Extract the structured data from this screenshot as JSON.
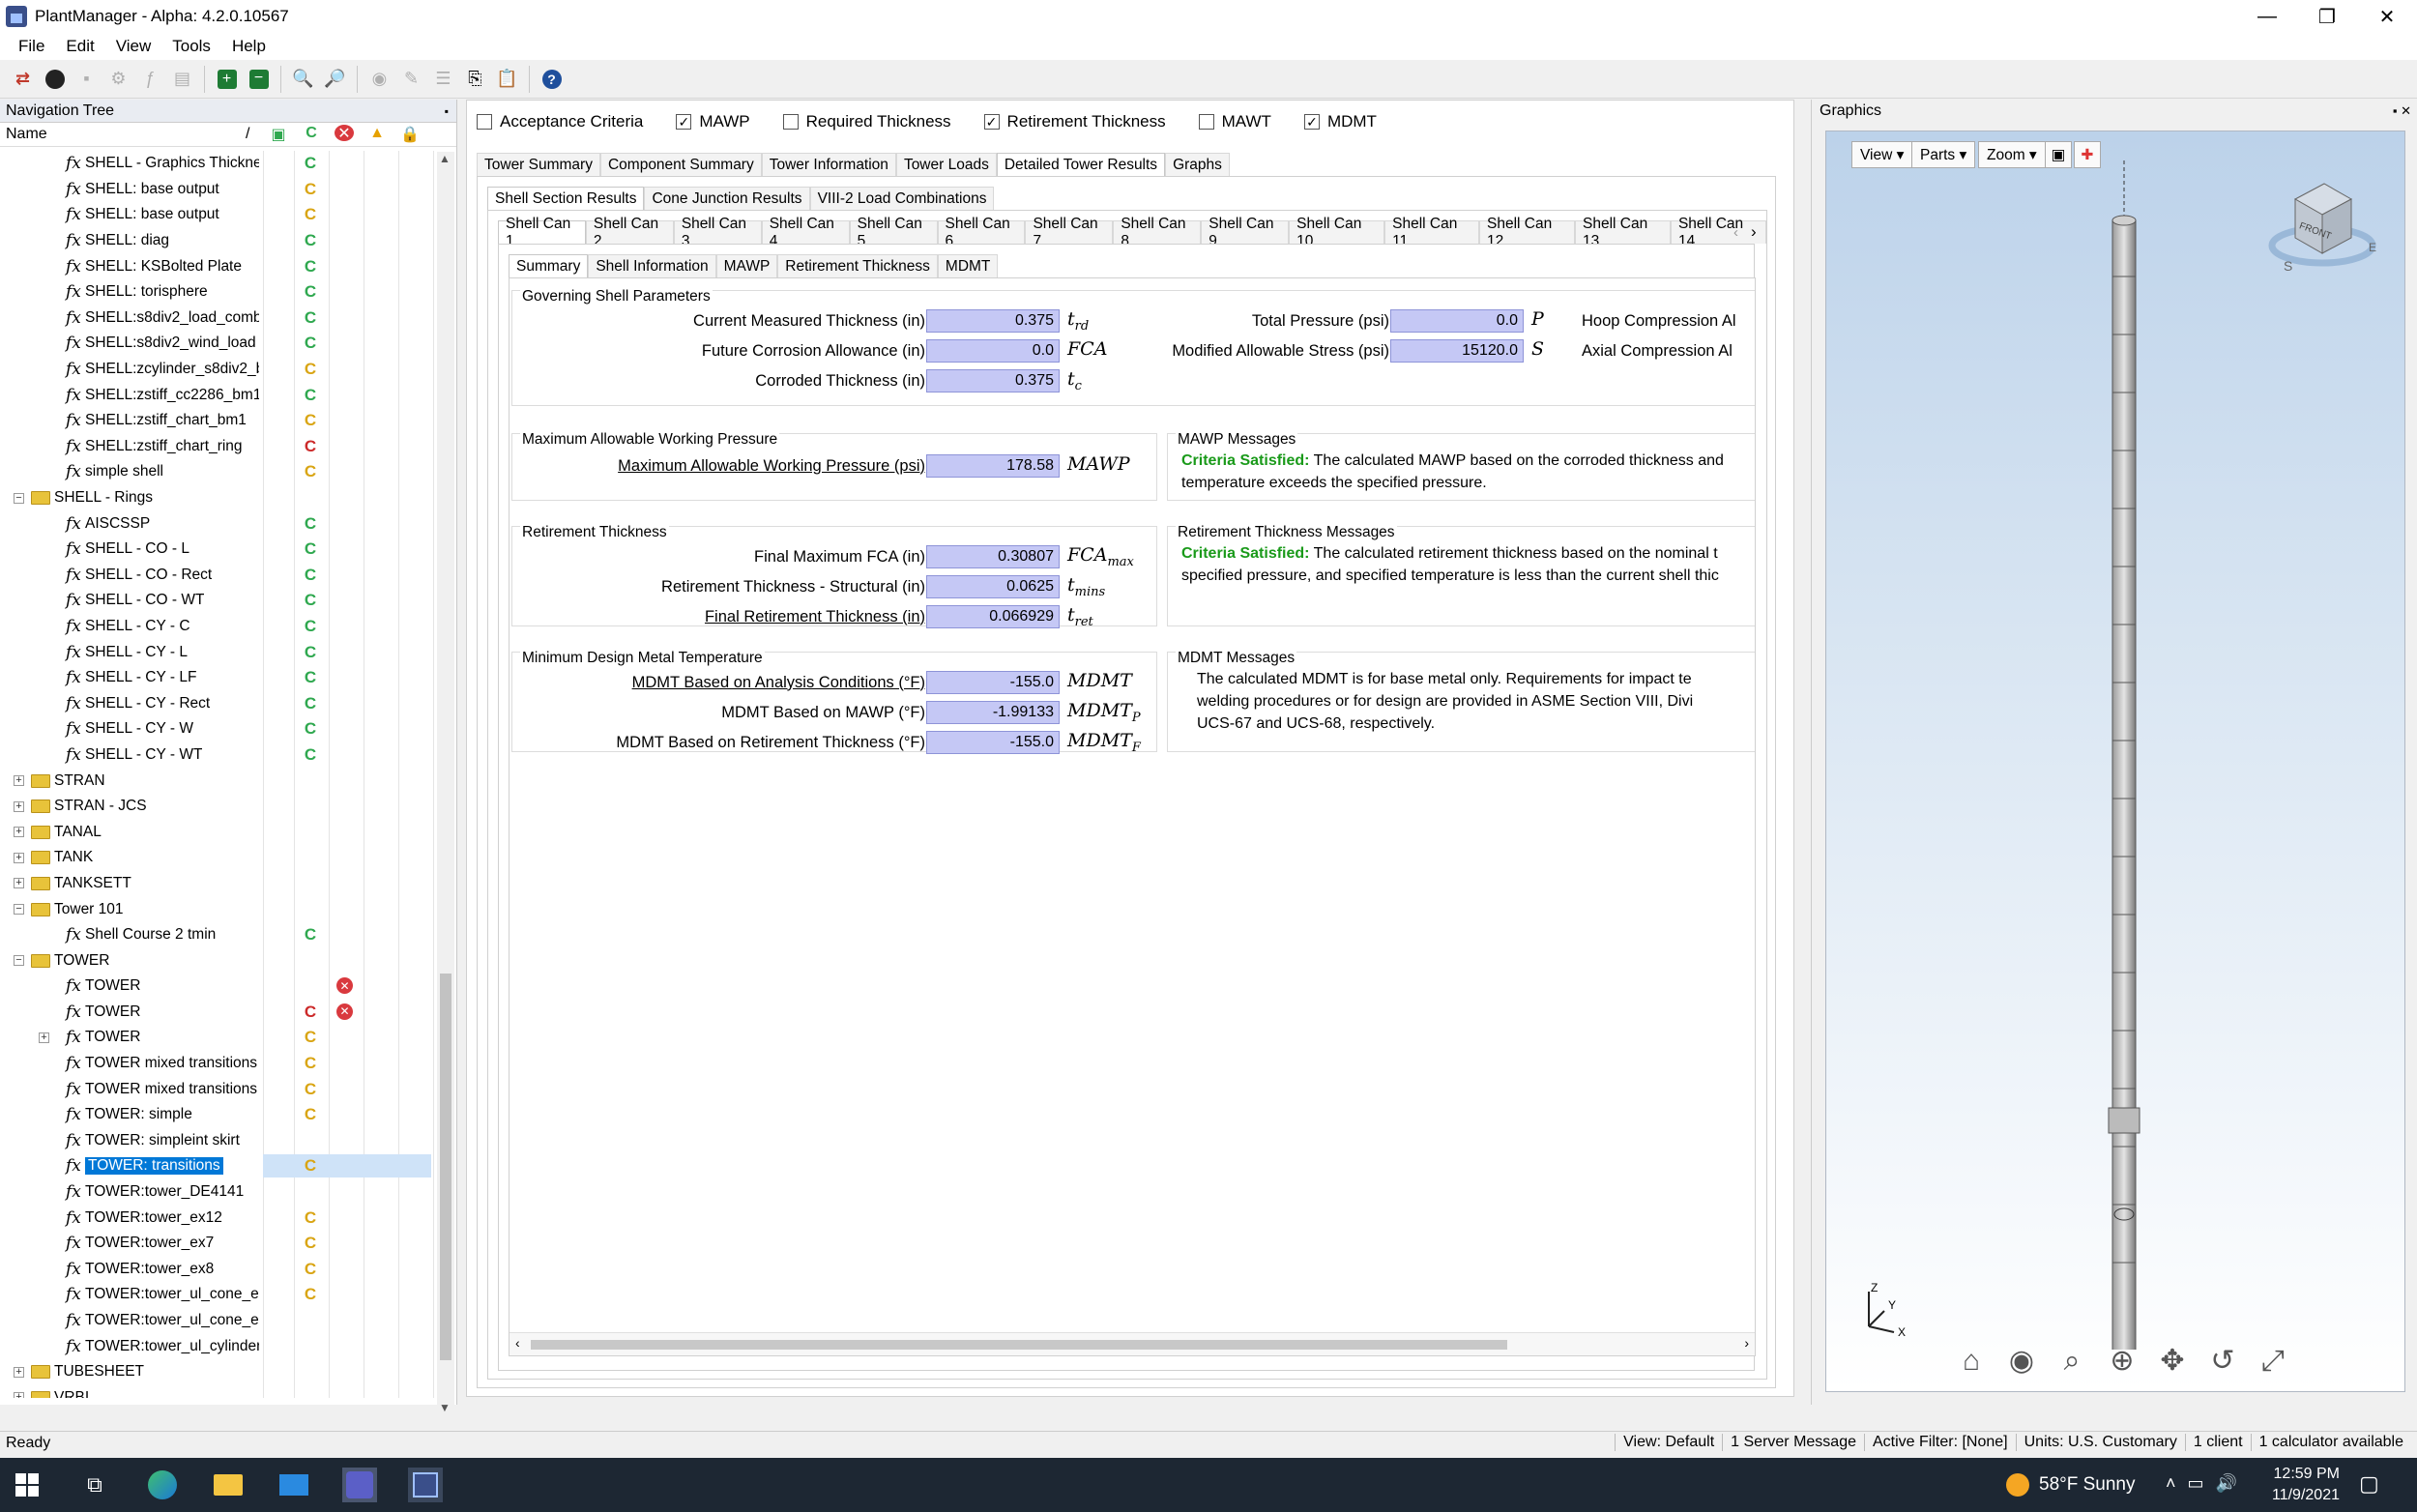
{
  "window": {
    "title": "PlantManager - Alpha: 4.2.0.10567",
    "minimize": "—",
    "maximize": "❐",
    "close": "✕"
  },
  "menu": [
    "File",
    "Edit",
    "View",
    "Tools",
    "Help"
  ],
  "nav": {
    "title": "Navigation Tree",
    "pin": "📌",
    "col_name": "Name",
    "sort_glyph": "/",
    "rows": [
      {
        "label": "SHELL - Graphics Thickness",
        "type": "fx",
        "indent": 2,
        "s1": "green"
      },
      {
        "label": "SHELL: base output",
        "type": "fx",
        "indent": 2,
        "s1": "yellow"
      },
      {
        "label": "SHELL: base output",
        "type": "fx",
        "indent": 2,
        "s1": "yellow"
      },
      {
        "label": "SHELL: diag",
        "type": "fx",
        "indent": 2,
        "s1": "green"
      },
      {
        "label": "SHELL: KSBolted Plate",
        "type": "fx",
        "indent": 2,
        "s1": "green"
      },
      {
        "label": "SHELL: torisphere",
        "type": "fx",
        "indent": 2,
        "s1": "green"
      },
      {
        "label": "SHELL:s8div2_load_comb",
        "type": "fx",
        "indent": 2,
        "s1": "green"
      },
      {
        "label": "SHELL:s8div2_wind_load",
        "type": "fx",
        "indent": 2,
        "s1": "green"
      },
      {
        "label": "SHELL:zcylinder_s8div2_b",
        "type": "fx",
        "indent": 2,
        "s1": "yellow"
      },
      {
        "label": "SHELL:zstiff_cc2286_bm1",
        "type": "fx",
        "indent": 2,
        "s1": "green"
      },
      {
        "label": "SHELL:zstiff_chart_bm1",
        "type": "fx",
        "indent": 2,
        "s1": "yellow"
      },
      {
        "label": "SHELL:zstiff_chart_ring",
        "type": "fx",
        "indent": 2,
        "s1": "red"
      },
      {
        "label": "simple shell",
        "type": "fx",
        "indent": 2,
        "s1": "yellow"
      },
      {
        "label": "SHELL - Rings",
        "type": "folder",
        "indent": 1,
        "exp": "−"
      },
      {
        "label": "AISCSSP",
        "type": "fx",
        "indent": 2,
        "s1": "green"
      },
      {
        "label": "SHELL - CO - L",
        "type": "fx",
        "indent": 2,
        "s1": "green"
      },
      {
        "label": "SHELL - CO - Rect",
        "type": "fx",
        "indent": 2,
        "s1": "green"
      },
      {
        "label": "SHELL - CO - WT",
        "type": "fx",
        "indent": 2,
        "s1": "green"
      },
      {
        "label": "SHELL - CY - C",
        "type": "fx",
        "indent": 2,
        "s1": "green"
      },
      {
        "label": "SHELL - CY - L",
        "type": "fx",
        "indent": 2,
        "s1": "green"
      },
      {
        "label": "SHELL - CY - LF",
        "type": "fx",
        "indent": 2,
        "s1": "green"
      },
      {
        "label": "SHELL - CY - Rect",
        "type": "fx",
        "indent": 2,
        "s1": "green"
      },
      {
        "label": "SHELL - CY - W",
        "type": "fx",
        "indent": 2,
        "s1": "green"
      },
      {
        "label": "SHELL - CY - WT",
        "type": "fx",
        "indent": 2,
        "s1": "green"
      },
      {
        "label": "STRAN",
        "type": "folder",
        "indent": 1,
        "exp": "+"
      },
      {
        "label": "STRAN - JCS",
        "type": "folder",
        "indent": 1,
        "exp": "+"
      },
      {
        "label": "TANAL",
        "type": "folder",
        "indent": 1,
        "exp": "+"
      },
      {
        "label": "TANK",
        "type": "folder",
        "indent": 1,
        "exp": "+"
      },
      {
        "label": "TANKSETT",
        "type": "folder",
        "indent": 1,
        "exp": "+"
      },
      {
        "label": "Tower 101",
        "type": "folder",
        "indent": 1,
        "exp": "−"
      },
      {
        "label": "Shell Course 2 tmin",
        "type": "fx",
        "indent": 2,
        "s1": "green"
      },
      {
        "label": "TOWER",
        "type": "folder",
        "indent": 1,
        "exp": "−"
      },
      {
        "label": "TOWER",
        "type": "fx",
        "indent": 2,
        "s2": "red"
      },
      {
        "label": "TOWER",
        "type": "fx",
        "indent": 2,
        "s1": "red",
        "s2": "red"
      },
      {
        "label": "TOWER",
        "type": "fx",
        "indent": 2,
        "s1": "yellow",
        "exp": "+"
      },
      {
        "label": "TOWER mixed transitions",
        "type": "fx",
        "indent": 2,
        "s1": "yellow"
      },
      {
        "label": "TOWER mixed transitions",
        "type": "fx",
        "indent": 2,
        "s1": "yellow"
      },
      {
        "label": "TOWER: simple",
        "type": "fx",
        "indent": 2,
        "s1": "yellow"
      },
      {
        "label": "TOWER: simpleint skirt",
        "type": "fx",
        "indent": 2
      },
      {
        "label": "TOWER: transitions",
        "type": "fx",
        "indent": 2,
        "s1": "yellow",
        "selected": true
      },
      {
        "label": "TOWER:tower_DE4141",
        "type": "fx",
        "indent": 2
      },
      {
        "label": "TOWER:tower_ex12",
        "type": "fx",
        "indent": 2,
        "s1": "yellow"
      },
      {
        "label": "TOWER:tower_ex7",
        "type": "fx",
        "indent": 2,
        "s1": "yellow"
      },
      {
        "label": "TOWER:tower_ex8",
        "type": "fx",
        "indent": 2,
        "s1": "yellow"
      },
      {
        "label": "TOWER:tower_ul_cone_e",
        "type": "fx",
        "indent": 2,
        "s1": "yellow"
      },
      {
        "label": "TOWER:tower_ul_cone_e",
        "type": "fx",
        "indent": 2
      },
      {
        "label": "TOWER:tower_ul_cylinder",
        "type": "fx",
        "indent": 2
      },
      {
        "label": "TUBESHEET",
        "type": "folder",
        "indent": 1,
        "exp": "+"
      },
      {
        "label": "VRBI",
        "type": "folder",
        "indent": 1,
        "exp": "+"
      }
    ]
  },
  "checkboxes": [
    {
      "label": "Acceptance Criteria",
      "checked": false
    },
    {
      "label": "MAWP",
      "checked": true
    },
    {
      "label": "Required Thickness",
      "checked": false
    },
    {
      "label": "Retirement Thickness",
      "checked": true
    },
    {
      "label": "MAWT",
      "checked": false
    },
    {
      "label": "MDMT",
      "checked": true
    }
  ],
  "main_tabs": [
    "Tower Summary",
    "Component Summary",
    "Tower Information",
    "Tower Loads",
    "Detailed Tower Results",
    "Graphs"
  ],
  "main_tab_active": 4,
  "result_tabs": [
    "Shell Section Results",
    "Cone Junction Results",
    "VIII-2 Load Combinations"
  ],
  "can_tabs": [
    "Shell Can 1",
    "Shell Can 2",
    "Shell Can 3",
    "Shell Can 4",
    "Shell Can 5",
    "Shell Can 6",
    "Shell Can 7",
    "Shell Can 8",
    "Shell Can 9",
    "Shell Can 10",
    "Shell Can 11",
    "Shell Can 12",
    "Shell Can 13",
    "Shell Can 14"
  ],
  "detail_tabs": [
    "Summary",
    "Shell Information",
    "MAWP",
    "Retirement Thickness",
    "MDMT"
  ],
  "governing": {
    "title": "Governing Shell Parameters",
    "cmt_label": "Current Measured Thickness (in)",
    "cmt_value": "0.375",
    "fca_label": "Future Corrosion Allowance (in)",
    "fca_value": "0.0",
    "fca_sym": "FCA",
    "ct_label": "Corroded Thickness (in)",
    "ct_value": "0.375",
    "tp_label": "Total Pressure (psi)",
    "tp_value": "0.0",
    "tp_sym": "P",
    "mas_label": "Modified Allowable Stress (psi)",
    "mas_value": "15120.0",
    "mas_sym": "S",
    "hoop_label": "Hoop Compression Al",
    "axial_label": "Axial Compression Al"
  },
  "mawp": {
    "title": "Maximum Allowable Working Pressure",
    "label": "Maximum Allowable Working Pressure (psi)",
    "value": "178.58",
    "sym": "MAWP",
    "msg_title": "MAWP Messages",
    "msg_ok": "Criteria Satisfied:",
    "msg_line1": " The calculated MAWP based on the corroded thickness and",
    "msg_line2": "temperature exceeds the specified pressure."
  },
  "retirement": {
    "title": "Retirement Thickness",
    "fca_label": "Final Maximum FCA (in)",
    "fca_value": "0.30807",
    "rts_label": "Retirement Thickness - Structural (in)",
    "rts_value": "0.0625",
    "frt_label": "Final Retirement Thickness (in)",
    "frt_value": "0.066929",
    "msg_title": "Retirement Thickness Messages",
    "msg_ok": "Criteria Satisfied:",
    "msg_line1": " The calculated retirement thickness based on the nominal t",
    "msg_line2": "specified pressure, and specified temperature is less than the current shell thic"
  },
  "mdmt": {
    "title": "Minimum Design Metal Temperature",
    "a_label": "MDMT Based on Analysis Conditions (°F)",
    "a_value": "-155.0",
    "a_sym": "MDMT",
    "b_label": "MDMT Based on MAWP (°F)",
    "b_value": "-1.99133",
    "c_label": "MDMT Based on Retirement Thickness (°F)",
    "c_value": "-155.0",
    "msg_title": "MDMT Messages",
    "msg_line1": "The calculated MDMT is for base metal only. Requirements for impact te",
    "msg_line2": "welding procedures or for design are provided in ASME Section VIII, Divi",
    "msg_line3": "UCS-67 and UCS-68, respectively."
  },
  "graphics": {
    "title": "Graphics",
    "view_btn": "View ▾",
    "parts_btn": "Parts ▾",
    "zoom_btn": "Zoom ▾",
    "cube_label": "FRONT"
  },
  "status": {
    "ready": "Ready",
    "cells": [
      "View: Default",
      "1 Server Message",
      "Active Filter: [None]",
      "Units: U.S. Customary",
      "1 client",
      "1 calculator available"
    ]
  },
  "taskbar": {
    "weather": "58°F  Sunny",
    "time": "12:59 PM",
    "date": "11/9/2021"
  }
}
